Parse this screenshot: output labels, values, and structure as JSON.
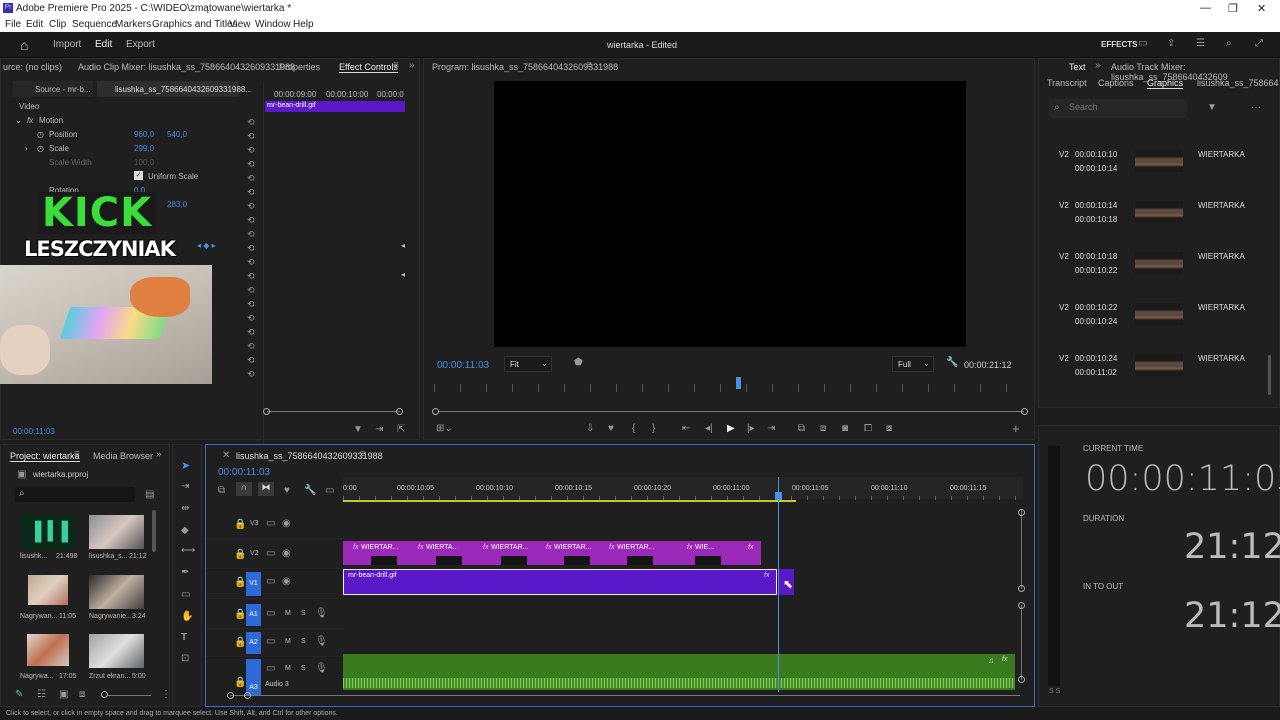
{
  "window": {
    "title": "Adobe Premiere Pro 2025 - C:\\WIDEO\\zmątowane\\wiertarka *",
    "logo": "Pr"
  },
  "menu": [
    "File",
    "Edit",
    "Clip",
    "Sequence",
    "Markers",
    "Graphics and Titles",
    "View",
    "Window",
    "Help"
  ],
  "appbar": {
    "tabs": [
      "Import",
      "Edit",
      "Export"
    ],
    "project_name": "wiertarka",
    "project_status": "- Edited",
    "effects_label": "EFFECTS"
  },
  "source_panel": {
    "tabs": [
      "urce: (no clips)",
      "Audio Clip Mixer: lisushka_ss_7586640432609331988",
      "Properties",
      "Effect Controls"
    ],
    "subtabs": [
      "Source - mr-b...",
      "lisushka_ss_7586640432609331988..."
    ],
    "video_label": "Video",
    "motion_label": "Motion",
    "position_label": "Position",
    "position_x": "960,0",
    "position_y": "540,0",
    "scale_label": "Scale",
    "scale_value": "299,0",
    "scale_width_label": "Scale Width",
    "scale_width_value": "100,0",
    "uniform_scale_label": "Uniform Scale",
    "rotation_label": "Rotation",
    "rotation_value": "0,0",
    "anchor_value": "283,0",
    "timecodes": [
      "00:00:09:00",
      "00:00:10:00",
      "00:00:0"
    ],
    "clip_name": "mr-bean-drill.gif",
    "current_time": "00:00:11:03"
  },
  "overlay": {
    "kick": "KICK",
    "name": "LESZCZYNIAK"
  },
  "program": {
    "title": "Program: lisushka_ss_7586640432609331988",
    "timecode": "00:00:11:03",
    "fit": "Fit",
    "quality": "Full",
    "duration": "00:00:21:12"
  },
  "right_panel": {
    "tabs": [
      "Text",
      "Audio Track Mixer: lisushka_ss_7586640432609"
    ],
    "subtabs": [
      "Transcript",
      "Captions",
      "Graphics",
      "lisushka_ss_758664"
    ],
    "search_placeholder": "Search",
    "items": [
      {
        "track": "V2",
        "in": "00:00:10:10",
        "out": "00:00:10:14",
        "label": "WIERTARKA"
      },
      {
        "track": "V2",
        "in": "00:00:10:14",
        "out": "00:00:10:18",
        "label": "WIERTARKA"
      },
      {
        "track": "V2",
        "in": "00:00:10:18",
        "out": "00:00:10:22",
        "label": "WIERTARKA"
      },
      {
        "track": "V2",
        "in": "00:00:10:22",
        "out": "00:00:10:24",
        "label": "WIERTARKA"
      },
      {
        "track": "V2",
        "in": "00:00:10:24",
        "out": "00:00:11:02",
        "label": "WIERTARKA"
      }
    ]
  },
  "info_panel": {
    "current_time_label": "CURRENT TIME",
    "current_time": "00:00:11:03",
    "duration_label": "DURATION",
    "duration": "21:12",
    "in_out_label": "IN TO OUT",
    "in_out": "21:12"
  },
  "project": {
    "tabs": [
      "Project: wiertarka",
      "Media Browser"
    ],
    "file": "wiertarka.prproj",
    "items": [
      {
        "name": "lisushk...",
        "dur": "21:498"
      },
      {
        "name": "lisushka_s...",
        "dur": "21:12"
      },
      {
        "name": "Nagrywan...",
        "dur": "11:05"
      },
      {
        "name": "Nagrywanie...",
        "dur": "3:24"
      },
      {
        "name": "Nagrywa...",
        "dur": "17:05"
      },
      {
        "name": "Zrzut ekran...",
        "dur": "5:00"
      }
    ]
  },
  "timeline": {
    "sequence": "lisushka_ss_7586640432609331988",
    "timecode": "00:00:11:03",
    "ruler": [
      "0:00",
      "00:00:10:05",
      "00:00:10:10",
      "00:00:10:15",
      "00:00:10:20",
      "00:00:11:00",
      "00:00:11:05",
      "00:00:11:10",
      "00:00:11:15"
    ],
    "tracks": [
      "V3",
      "V2",
      "V1",
      "A1",
      "A2",
      "A3"
    ],
    "audio3_label": "Audio 3",
    "v2_clips": [
      "WIERTAR...",
      "WIERTA...",
      "WIERTAR...",
      "WIERTAR...",
      "WIERTAR...",
      "WIE..."
    ],
    "v1_clip": "mr-bean-drill.gif"
  },
  "status_bar": "Click to select, or click in empty space and drag to marquee select. Use Shift, Alt, and Ctrl for other options.",
  "colors": {
    "accent": "#2d8ceb",
    "v2": "#9a28b8",
    "v1": "#5a18c8",
    "audio": "#3a7a1e"
  }
}
